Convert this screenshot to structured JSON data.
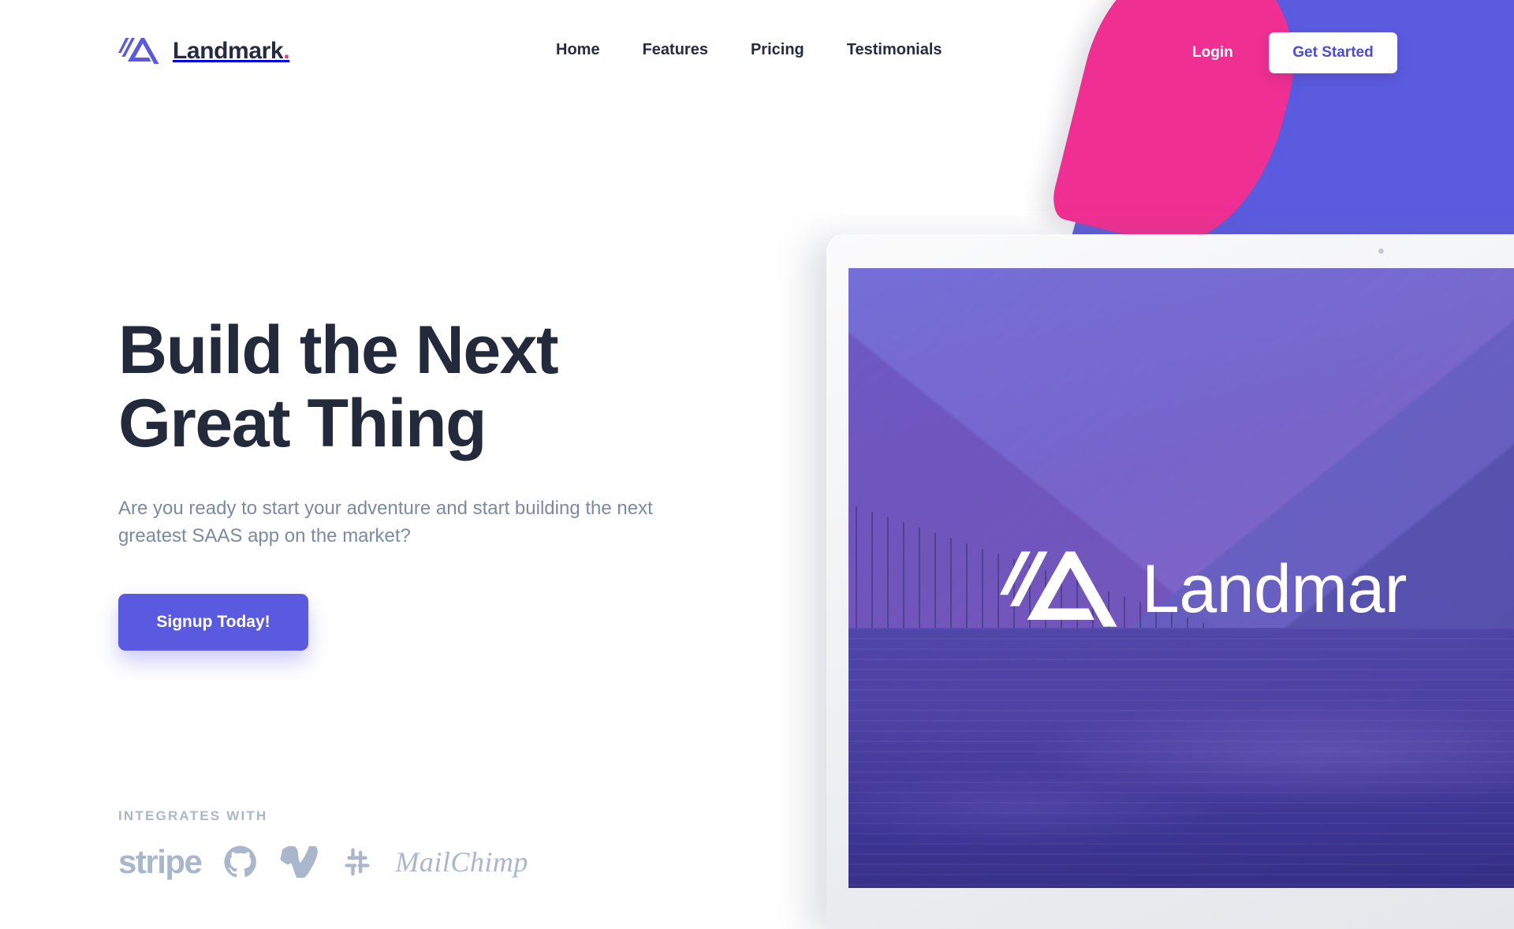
{
  "brand": {
    "name": "Landmark",
    "dot": ".",
    "mark_icon": "landmark-mountain-logo-icon"
  },
  "nav": {
    "items": [
      {
        "label": "Home"
      },
      {
        "label": "Features"
      },
      {
        "label": "Pricing"
      },
      {
        "label": "Testimonials"
      }
    ],
    "login_label": "Login",
    "get_started_label": "Get Started"
  },
  "hero": {
    "title_line1": "Build the Next",
    "title_line2": "Great Thing",
    "subtitle": "Are you ready to start your adventure and start building the next greatest SAAS app on the market?",
    "cta_label": "Signup Today!"
  },
  "integrations": {
    "label": "INTEGRATES WITH",
    "logos": [
      {
        "name": "stripe",
        "text": "stripe",
        "icon": "stripe-wordmark-icon"
      },
      {
        "name": "github",
        "text": "",
        "icon": "github-octocat-icon"
      },
      {
        "name": "vimeo",
        "text": "",
        "icon": "vimeo-v-icon"
      },
      {
        "name": "slack",
        "text": "",
        "icon": "slack-hash-icon"
      },
      {
        "name": "mailchimp",
        "text": "MailChimp",
        "icon": "mailchimp-wordmark-icon"
      }
    ]
  },
  "laptop": {
    "screen_brand_text": "Landmar",
    "screen_brand_icon": "landmark-mountain-logo-icon",
    "scene": "mountain-lake-forest-photo"
  },
  "colors": {
    "accent_blue": "#5a5ae0",
    "accent_pink": "#ef2f91",
    "heading_navy": "#222a3c",
    "body_gray": "#7b8aa3",
    "muted_blue_gray": "#a9b7cc",
    "white": "#ffffff"
  }
}
